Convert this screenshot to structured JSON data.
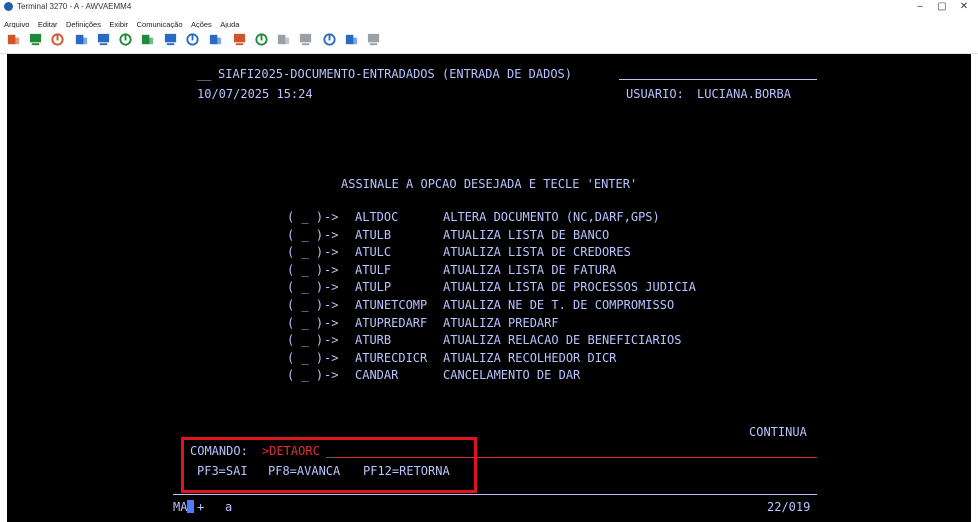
{
  "window": {
    "title": "Terminal 3270 - A - AWVAEMM4",
    "controls": {
      "minimize": "–",
      "maximize": "▢",
      "close": "✕"
    }
  },
  "menu": [
    "Arquivo",
    "Editar",
    "Definições",
    "Exibir",
    "Comunicação",
    "Ações",
    "Ajuda"
  ],
  "toolbar": {
    "icons": [
      "connect-icon",
      "disconnect-icon",
      "exit-icon",
      "send-icon",
      "receive-icon",
      "copy-icon",
      "paste-icon",
      "print-icon",
      "keyboard-icon",
      "macro-icon",
      "record-icon",
      "play-icon",
      "stop-icon",
      "pause-icon",
      "link-icon",
      "upload-icon",
      "settings-icon"
    ],
    "colors": [
      "#d2542c",
      "#1f8a3a",
      "#d2542c",
      "#2a6bc2",
      "#2a6bc2",
      "#1f8a3a",
      "#1f8a3a",
      "#2a6bc2",
      "#2a6bc2",
      "#2a6bc2",
      "#d2542c",
      "#1f8a3a",
      "#9aa0a6",
      "#9aa0a6",
      "#2a6bc2",
      "#2a6bc2",
      "#9aa0a6"
    ]
  },
  "screen": {
    "header_prefix": "__",
    "title": "SIAFI2025-DOCUMENTO-ENTRADADOS (ENTRADA DE DADOS)",
    "datetime": "10/07/2025 15:24",
    "user_label": "USUARIO:",
    "user": "LUCIANA.BORBA",
    "instruction": "ASSINALE A OPCAO DESEJADA E TECLE 'ENTER'",
    "options": [
      {
        "select": "( _ )",
        "arrow": "->",
        "code": "ALTDOC",
        "description": "ALTERA DOCUMENTO (NC,DARF,GPS)"
      },
      {
        "select": "( _ )",
        "arrow": "->",
        "code": "ATULB",
        "description": "ATUALIZA LISTA DE BANCO"
      },
      {
        "select": "( _ )",
        "arrow": "->",
        "code": "ATULC",
        "description": "ATUALIZA LISTA DE CREDORES"
      },
      {
        "select": "( _ )",
        "arrow": "->",
        "code": "ATULF",
        "description": "ATUALIZA LISTA DE FATURA"
      },
      {
        "select": "( _ )",
        "arrow": "->",
        "code": "ATULP",
        "description": "ATUALIZA LISTA DE PROCESSOS JUDICIA"
      },
      {
        "select": "( _ )",
        "arrow": "->",
        "code": "ATUNETCOMP",
        "description": "ATUALIZA NE DE T. DE COMPROMISSO"
      },
      {
        "select": "( _ )",
        "arrow": "->",
        "code": "ATUPREDARF",
        "description": "ATUALIZA PREDARF"
      },
      {
        "select": "( _ )",
        "arrow": "->",
        "code": "ATURB",
        "description": "ATUALIZA RELACAO DE BENEFICIARIOS"
      },
      {
        "select": "( _ )",
        "arrow": "->",
        "code": "ATURECDICR",
        "description": "ATUALIZA RECOLHEDOR DICR"
      },
      {
        "select": "( _ )",
        "arrow": "->",
        "code": "CANDAR",
        "description": "CANCELAMENTO DE DAR"
      }
    ],
    "continua": "CONTINUA",
    "command_label": "COMANDO:",
    "command_value": ">DETAORC",
    "command_cursor": "_",
    "function_keys": [
      "PF3=SAI",
      "PF8=AVANCA",
      "PF12=RETORNA"
    ],
    "status": {
      "mode": "MA",
      "indicator": "+",
      "field": "a",
      "position": "22/019"
    }
  },
  "colors": {
    "screen_bg": "#000000",
    "screen_text": "#b8c3ff",
    "command_value": "#e03030",
    "annotation_box": "#e0141d",
    "cursor": "#4d7cff"
  }
}
